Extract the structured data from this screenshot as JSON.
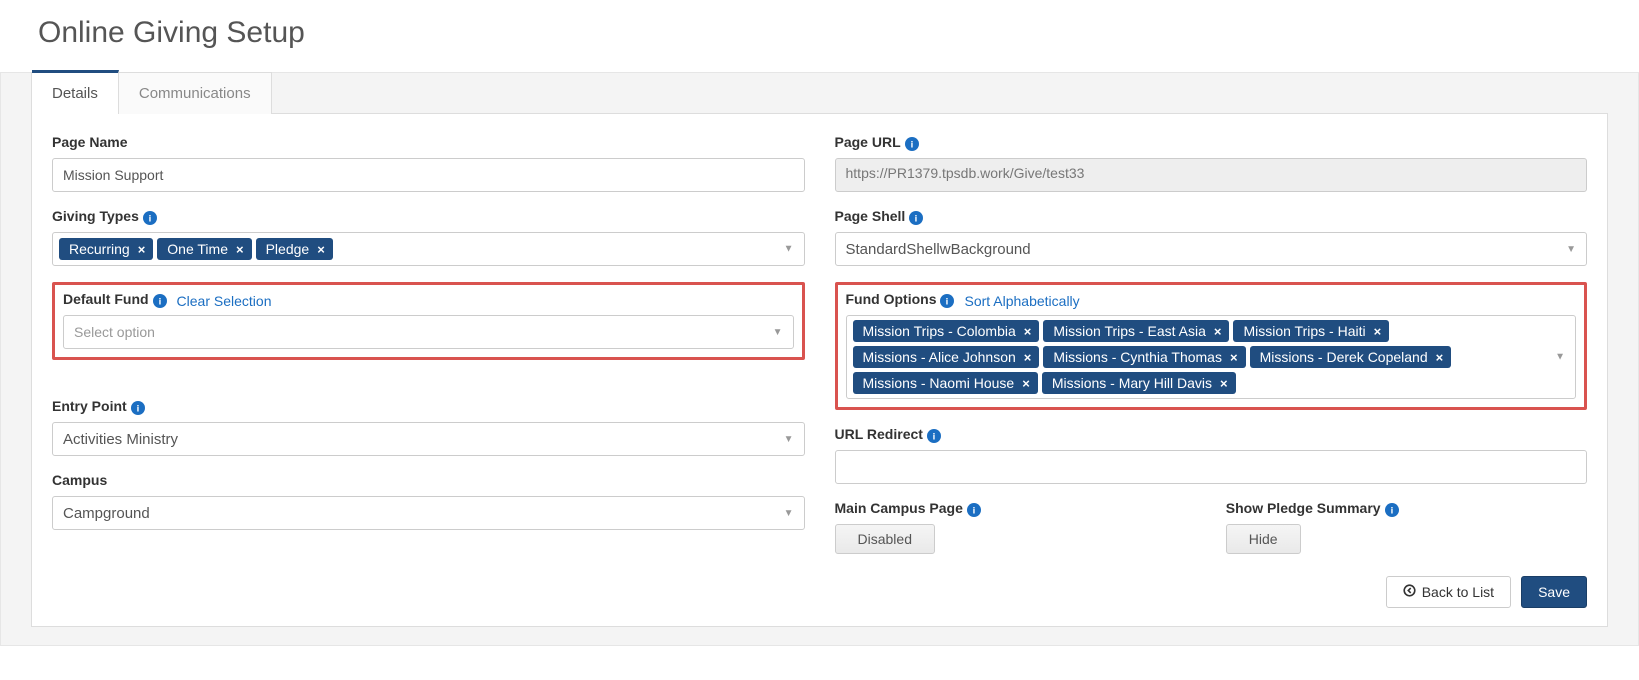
{
  "page_title": "Online Giving Setup",
  "tabs": {
    "details": "Details",
    "communications": "Communications"
  },
  "left": {
    "page_name": {
      "label": "Page Name",
      "value": "Mission Support"
    },
    "giving_types": {
      "label": "Giving Types",
      "items": [
        "Recurring",
        "One Time",
        "Pledge"
      ]
    },
    "default_fund": {
      "label": "Default Fund",
      "clear": "Clear Selection",
      "placeholder": "Select option"
    },
    "entry_point": {
      "label": "Entry Point",
      "value": "Activities Ministry"
    },
    "campus": {
      "label": "Campus",
      "value": "Campground"
    }
  },
  "right": {
    "page_url": {
      "label": "Page URL",
      "value": "https://PR1379.tpsdb.work/Give/test33"
    },
    "page_shell": {
      "label": "Page Shell",
      "value": "StandardShellwBackground"
    },
    "fund_options": {
      "label": "Fund Options",
      "sort": "Sort Alphabetically",
      "items": [
        "Mission Trips - Colombia",
        "Mission Trips - East Asia",
        "Mission Trips - Haiti",
        "Missions - Alice Johnson",
        "Missions - Cynthia Thomas",
        "Missions - Derek Copeland",
        "Missions - Naomi House",
        "Missions - Mary Hill Davis"
      ]
    },
    "url_redirect": {
      "label": "URL Redirect"
    },
    "main_campus": {
      "label": "Main Campus Page",
      "value": "Disabled"
    },
    "show_pledge": {
      "label": "Show Pledge Summary",
      "value": "Hide"
    }
  },
  "footer": {
    "back": "Back to List",
    "save": "Save"
  }
}
